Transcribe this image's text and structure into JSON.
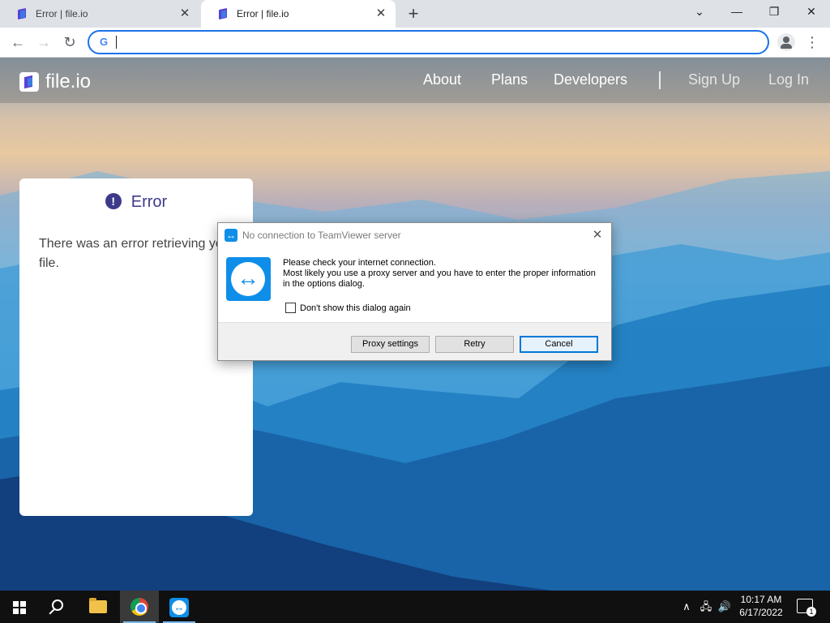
{
  "browser": {
    "tabs": [
      {
        "title": "Error | file.io",
        "close": "✕"
      },
      {
        "title": "Error | file.io",
        "close": "✕"
      }
    ],
    "new_tab": "+",
    "window_controls": {
      "minimize": "—",
      "restore": "❐",
      "close": "✕",
      "tab_search": "⌄"
    },
    "nav": {
      "back": "←",
      "forward": "→",
      "reload": "↻"
    },
    "omnibox": {
      "value": "",
      "google_glyph": "G"
    },
    "menu": "⋮"
  },
  "site": {
    "logo_text": "file.io",
    "nav": {
      "about": "About",
      "plans": "Plans",
      "developers": "Developers",
      "sign_up": "Sign Up",
      "log_in": "Log In"
    },
    "error_card": {
      "icon": "!",
      "title": "Error",
      "message": "There was an error retrieving your file."
    }
  },
  "dialog": {
    "title": "No connection to TeamViewer server",
    "close": "✕",
    "message_lines": [
      "Please check your internet connection.",
      "Most likely you use a proxy server and you have to enter the proper information in the options dialog."
    ],
    "checkbox_label": "Don't show this dialog again",
    "buttons": {
      "proxy": "Proxy settings",
      "retry": "Retry",
      "cancel": "Cancel"
    }
  },
  "taskbar": {
    "tray": {
      "chevron": "∧",
      "network": "🖧",
      "volume": "🔊"
    },
    "time": "10:17 AM",
    "date": "6/17/2022",
    "notifications": "1"
  }
}
